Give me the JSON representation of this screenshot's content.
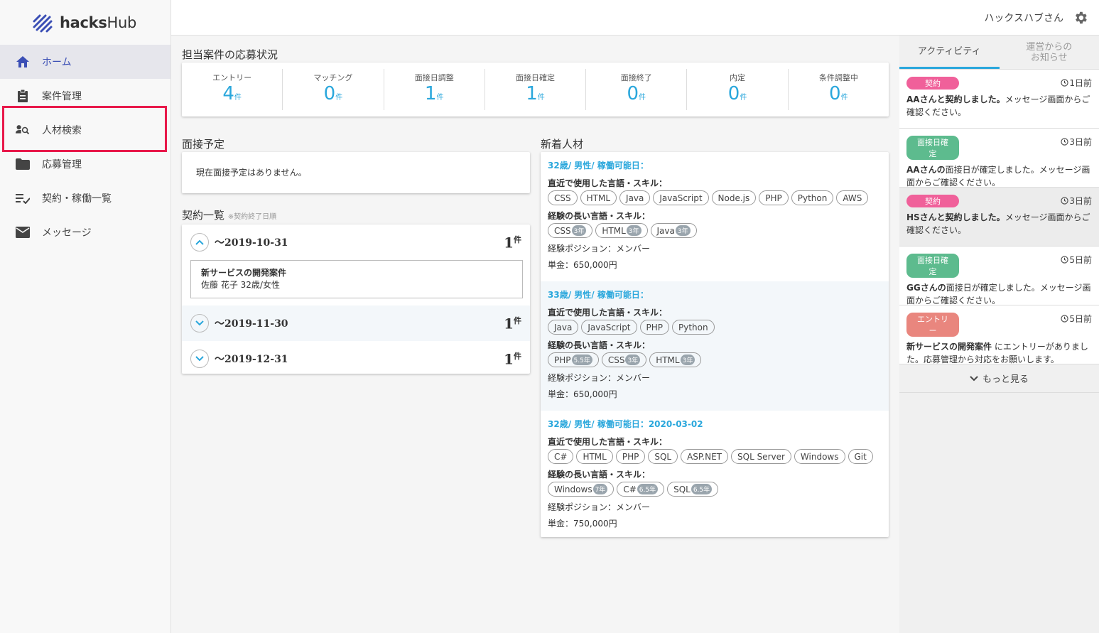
{
  "app": {
    "logo_text_bold": "hacks",
    "logo_text_light": "Hub",
    "user_name": "ハックスハブさん"
  },
  "nav": [
    {
      "label": "ホーム"
    },
    {
      "label": "案件管理"
    },
    {
      "label": "人材検索"
    },
    {
      "label": "応募管理"
    },
    {
      "label": "契約・稼働一覧"
    },
    {
      "label": "メッセージ"
    }
  ],
  "status": {
    "title": "担当案件の応募状況",
    "unit": "件",
    "items": [
      {
        "label": "エントリー",
        "value": "4"
      },
      {
        "label": "マッチング",
        "value": "0"
      },
      {
        "label": "面接日調整",
        "value": "1"
      },
      {
        "label": "面接日確定",
        "value": "1"
      },
      {
        "label": "面接終了",
        "value": "0"
      },
      {
        "label": "内定",
        "value": "0"
      },
      {
        "label": "条件調整中",
        "value": "0"
      }
    ]
  },
  "interview": {
    "title": "面接予定",
    "empty": "現在面接予定はありません。"
  },
  "contracts": {
    "title": "契約一覧",
    "note": "※契約終了日順",
    "unit": "件",
    "groups": [
      {
        "date": "～2019-10-31",
        "count": "1",
        "detail_title": "新サービスの開発案件",
        "detail_sub": "佐藤 花子 32歳/女性"
      },
      {
        "date": "～2019-11-30",
        "count": "1"
      },
      {
        "date": "～2019-12-31",
        "count": "1"
      }
    ]
  },
  "talents": {
    "title": "新着人材",
    "recent_label": "直近で使用した言語・スキル：",
    "long_label": "経験の長い言語・スキル：",
    "items": [
      {
        "head": "32歳/ 男性/ 稼働可能日：",
        "recent": [
          "CSS",
          "HTML",
          "Java",
          "JavaScript",
          "Node.js",
          "PHP",
          "Python",
          "AWS"
        ],
        "long": [
          {
            "n": "CSS",
            "y": "3年"
          },
          {
            "n": "HTML",
            "y": "3年"
          },
          {
            "n": "Java",
            "y": "3年"
          }
        ],
        "position": "経験ポジション：メンバー",
        "price": "単金：650,000円"
      },
      {
        "head": "33歳/ 男性/ 稼働可能日：",
        "recent": [
          "Java",
          "JavaScript",
          "PHP",
          "Python"
        ],
        "long": [
          {
            "n": "PHP",
            "y": "5.5年"
          },
          {
            "n": "CSS",
            "y": "3年"
          },
          {
            "n": "HTML",
            "y": "3年"
          }
        ],
        "position": "経験ポジション：メンバー",
        "price": "単金：650,000円"
      },
      {
        "head": "32歳/ 男性/ 稼働可能日：2020-03-02",
        "recent": [
          "C#",
          "HTML",
          "PHP",
          "SQL",
          "ASP.NET",
          "SQL Server",
          "Windows",
          "Git"
        ],
        "long": [
          {
            "n": "Windows",
            "y": "7年"
          },
          {
            "n": "C#",
            "y": "6.5年"
          },
          {
            "n": "SQL",
            "y": "6.5年"
          }
        ],
        "position": "経験ポジション：メンバー",
        "price": "単金：750,000円"
      }
    ]
  },
  "activity": {
    "tabs": [
      "アクティビティ",
      "運営からの\nお知らせ"
    ],
    "items": [
      {
        "badge": "契約",
        "color": "#f0609a",
        "time": "1日前",
        "text_bold": "AAさんと契約しました。",
        "text": "メッセージ画面からご確認ください。"
      },
      {
        "badge": "面接日確定",
        "color": "#5dbb8e",
        "time": "3日前",
        "text_bold": "AAさんの",
        "text": "面接日が確定しました。メッセージ画面からご確認ください。"
      },
      {
        "badge": "契約",
        "color": "#f0609a",
        "time": "3日前",
        "text_bold": "HSさんと契約しました。",
        "text": "メッセージ画面からご確認ください。"
      },
      {
        "badge": "面接日確定",
        "color": "#5dbb8e",
        "time": "5日前",
        "text_bold": "GGさんの",
        "text": "面接日が確定しました。メッセージ画面からご確認ください。"
      },
      {
        "badge": "エントリー",
        "color": "#e9867e",
        "time": "5日前",
        "text_bold": "新サービスの開発案件",
        "text": " にエントリーがありました。応募管理から対応をお願いします。"
      }
    ],
    "more": "もっと見る"
  }
}
